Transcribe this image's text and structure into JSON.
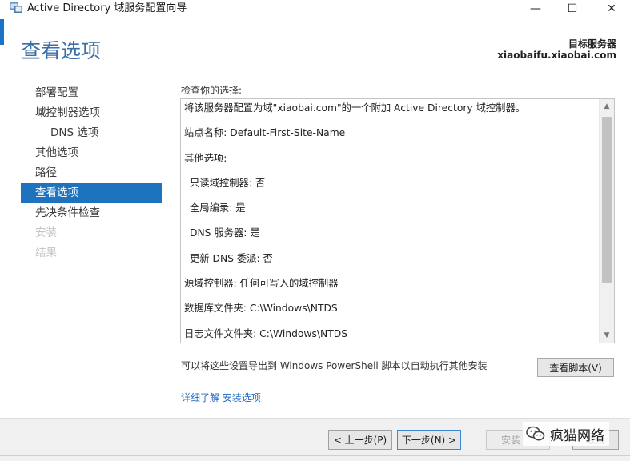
{
  "window": {
    "title": "Active Directory 域服务配置向导",
    "controls": {
      "minimize": "—",
      "maximize": "☐",
      "close": "✕"
    }
  },
  "header": {
    "page_title": "查看选项",
    "server_label": "目标服务器",
    "server_name": "xiaobaifu.xiaobai.com"
  },
  "nav": {
    "items": [
      {
        "label": "部署配置",
        "state": "normal"
      },
      {
        "label": "域控制器选项",
        "state": "normal"
      },
      {
        "label": "DNS 选项",
        "state": "sub"
      },
      {
        "label": "其他选项",
        "state": "normal"
      },
      {
        "label": "路径",
        "state": "normal"
      },
      {
        "label": "查看选项",
        "state": "active"
      },
      {
        "label": "先决条件检查",
        "state": "normal"
      },
      {
        "label": "安装",
        "state": "disabled"
      },
      {
        "label": "结果",
        "state": "disabled"
      }
    ]
  },
  "review": {
    "label": "检查你的选择:",
    "lines": [
      "将该服务器配置为域\"xiaobai.com\"的一个附加 Active Directory 域控制器。",
      "站点名称: Default-First-Site-Name",
      "其他选项:",
      "只读域控制器: 否",
      "全局编录: 是",
      "DNS 服务器: 是",
      "更新 DNS 委派: 否",
      "源域控制器: 任何可写入的域控制器",
      "数据库文件夹: C:\\Windows\\NTDS",
      "日志文件文件夹: C:\\Windows\\NTDS"
    ],
    "scroll_up": "▲",
    "scroll_down": "▼"
  },
  "export": {
    "text": "可以将这些设置导出到 Windows PowerShell 脚本以自动执行其他安装",
    "button": "查看脚本(V)"
  },
  "more_link": "详细了解 安装选项",
  "footer": {
    "prev": "< 上一步(P)",
    "next": "下一步(N) >",
    "install": "安装",
    "cancel": "取消"
  },
  "watermark": {
    "text": "疯猫网络"
  },
  "colors": {
    "accent": "#1e73be",
    "heading": "#3a6ea5",
    "link": "#1f66c1"
  }
}
